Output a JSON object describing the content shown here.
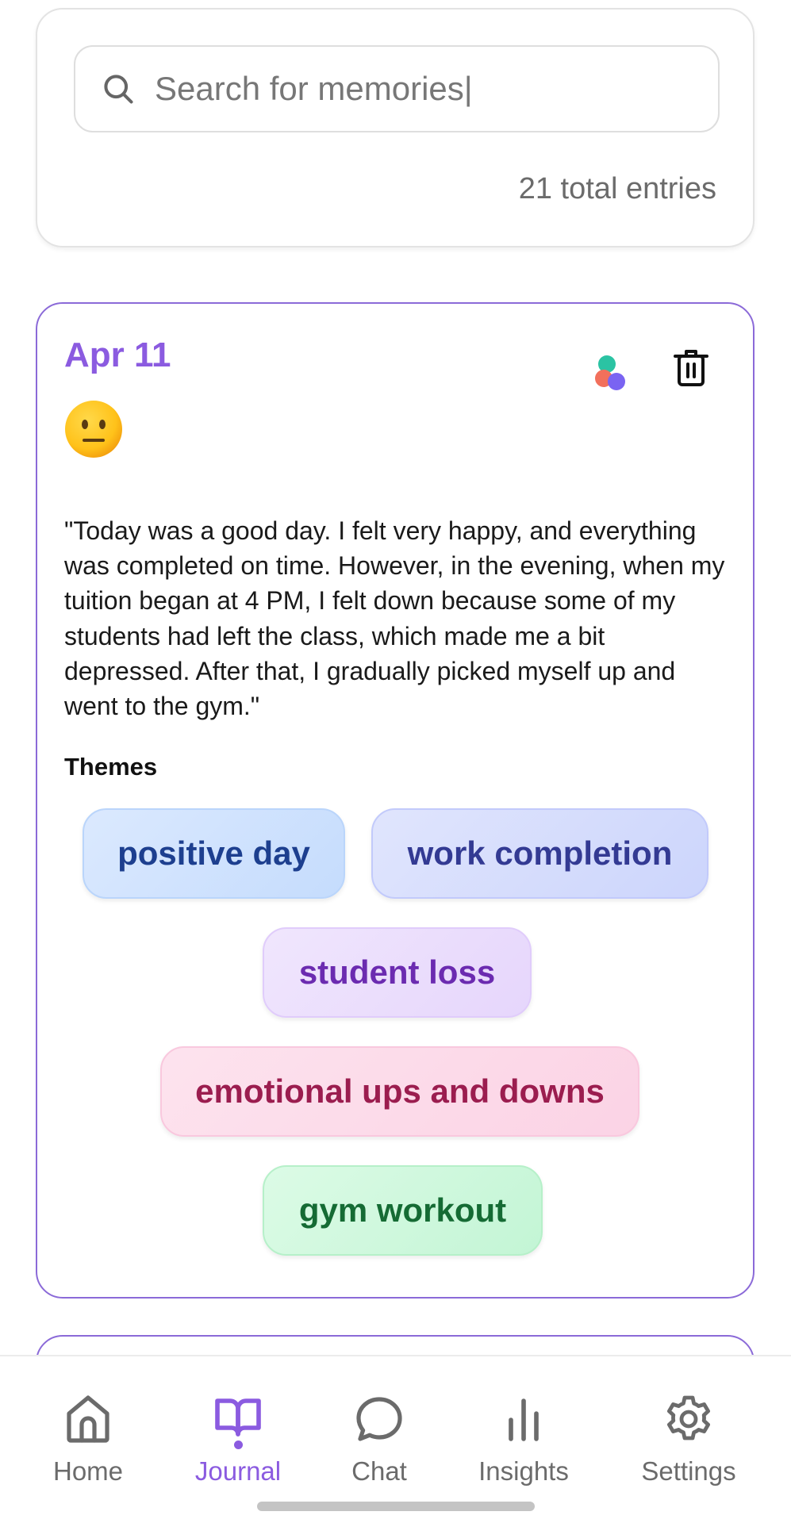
{
  "search": {
    "placeholder": "Search for memories|",
    "value": "",
    "total_entries": "21 total entries"
  },
  "entry": {
    "date": "Apr 11",
    "mood_icon": "neutral-face-emoji",
    "text": "\"Today was a good day. I felt very happy, and everything was completed on time. However, in the evening, when my tuition began at 4 PM, I felt down because some of my students had left the class, which made me a bit depressed. After that, I gradually picked myself up and went to the gym.\"",
    "themes_label": "Themes",
    "themes": [
      {
        "label": "positive day",
        "color": "#1d3f8f"
      },
      {
        "label": "work completion",
        "color": "#333a93"
      },
      {
        "label": "student loss",
        "color": "#6b2bb0"
      },
      {
        "label": "emotional ups and downs",
        "color": "#9b1d4f"
      },
      {
        "label": "gym workout",
        "color": "#156b34"
      }
    ]
  },
  "nav": {
    "items": [
      {
        "label": "Home",
        "icon": "home-icon"
      },
      {
        "label": "Journal",
        "icon": "book-icon",
        "active": true
      },
      {
        "label": "Chat",
        "icon": "chat-bubble-icon"
      },
      {
        "label": "Insights",
        "icon": "bar-chart-icon"
      },
      {
        "label": "Settings",
        "icon": "gear-icon"
      }
    ]
  },
  "colors": {
    "accent": "#8b5be0",
    "card_border": "#8b6ad8",
    "muted_text": "#6b6b6b"
  }
}
